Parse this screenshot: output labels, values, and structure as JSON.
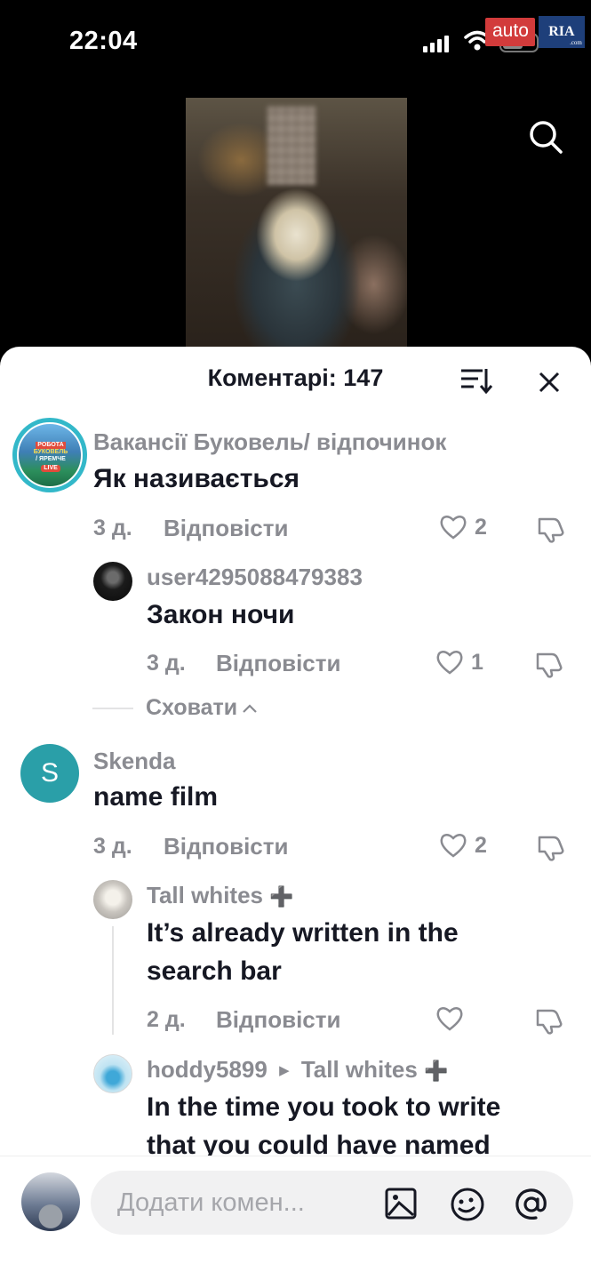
{
  "status_bar": {
    "time": "22:04",
    "watermark_auto": "auto",
    "watermark_ria": "RIA"
  },
  "video": {
    "search_icon": "search-icon"
  },
  "comments_sheet": {
    "title": "Коментарі: 147",
    "sort_icon": "sort-icon",
    "close_icon": "close-icon",
    "reply_label": "Відповісти",
    "hide_label": "Сховати",
    "comments": [
      {
        "author": "Вакансії Буковель/ відпочинок",
        "avatar_text": [
          "РОБОТА",
          "БУКОВЕЛЬ",
          "/ ЯРЕМЧЕ",
          "LIVE"
        ],
        "text": "Як називається",
        "time": "3 д.",
        "likes": "2",
        "replies": [
          {
            "author": "user4295088479383",
            "text": "Закон ночи",
            "time": "3 д.",
            "likes": "1"
          }
        ]
      },
      {
        "author": "Skenda",
        "avatar_letter": "S",
        "text": "name film",
        "time": "3 д.",
        "likes": "2",
        "replies": [
          {
            "author": "Tall whites",
            "badge": "➕",
            "text_line1": "It’s already written in the",
            "text_line2": "search bar",
            "time": "2 д.",
            "likes": ""
          },
          {
            "author": "hoddy5899",
            "reply_to": "Tall whites",
            "badge": "➕",
            "text_line1": "In the time you took to write",
            "text_line2": "that you could have named"
          }
        ]
      }
    ]
  },
  "input": {
    "placeholder": "Додати комен...",
    "icons": [
      "image-icon",
      "emoji-icon",
      "mention-icon"
    ]
  }
}
